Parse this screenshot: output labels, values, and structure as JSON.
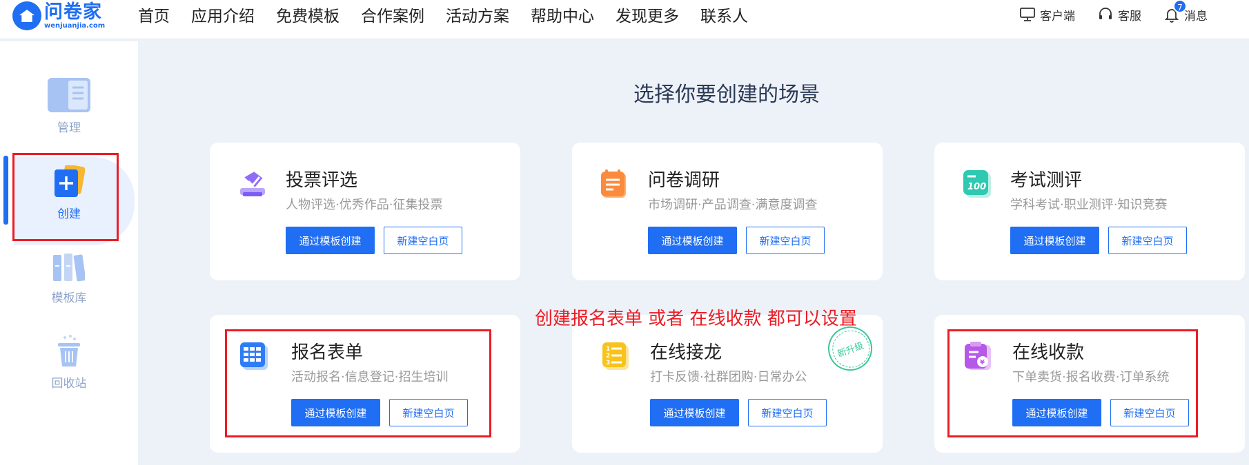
{
  "header": {
    "logo_name": "问卷家",
    "logo_domain": "wenjuanjia.com",
    "nav": [
      "首页",
      "应用介绍",
      "免费模板",
      "合作案例",
      "活动方案",
      "帮助中心",
      "发现更多",
      "联系人"
    ],
    "client_label": "客户端",
    "service_label": "客服",
    "message_label": "消息",
    "message_count": "7"
  },
  "sidebar": {
    "items": [
      {
        "label": "管理",
        "icon": "manage-icon"
      },
      {
        "label": "创建",
        "icon": "create-icon",
        "active": true
      },
      {
        "label": "模板库",
        "icon": "template-library-icon"
      },
      {
        "label": "回收站",
        "icon": "trash-icon"
      }
    ]
  },
  "main": {
    "title": "选择你要创建的场景",
    "cards": [
      {
        "title": "投票评选",
        "subtitle": "人物评选·优秀作品·征集投票",
        "template_btn": "通过模板创建",
        "blank_btn": "新建空白页",
        "icon": "vote-icon",
        "color": "#7b5cf6"
      },
      {
        "title": "问卷调研",
        "subtitle": "市场调研·产品调查·满意度调查",
        "template_btn": "通过模板创建",
        "blank_btn": "新建空白页",
        "icon": "survey-icon",
        "color": "#fb8a3c"
      },
      {
        "title": "考试测评",
        "subtitle": "学科考试·职业测评·知识竞赛",
        "template_btn": "通过模板创建",
        "blank_btn": "新建空白页",
        "icon": "exam-icon",
        "color": "#2ec9b0"
      },
      {
        "title": "报名表单",
        "subtitle": "活动报名·信息登记·招生培训",
        "template_btn": "通过模板创建",
        "blank_btn": "新建空白页",
        "icon": "form-icon",
        "color": "#2f7df6"
      },
      {
        "title": "在线接龙",
        "subtitle": "打卡反馈·社群团购·日常办公",
        "template_btn": "通过模板创建",
        "blank_btn": "新建空白页",
        "icon": "relay-icon",
        "color": "#f7c31c"
      },
      {
        "title": "在线收款",
        "subtitle": "下单卖货·报名收费·订单系统",
        "template_btn": "通过模板创建",
        "blank_btn": "新建空白页",
        "icon": "payment-icon",
        "color": "#b658e8"
      }
    ],
    "annotation": "创建报名表单  或者 在线收款 都可以设置",
    "stamp": "新升级"
  },
  "colors": {
    "accent": "#1f6ef3",
    "annotation_red": "#ec1c24"
  }
}
